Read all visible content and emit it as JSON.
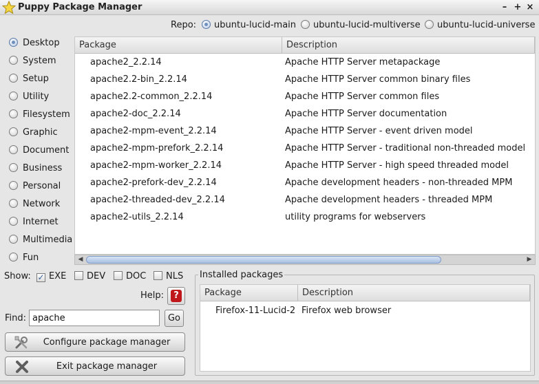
{
  "window": {
    "title": "Puppy Package Manager",
    "btn_min": "–",
    "btn_max": "+",
    "btn_close": "×"
  },
  "repo": {
    "label": "Repo:",
    "options": [
      {
        "label": "ubuntu-lucid-main",
        "selected": true
      },
      {
        "label": "ubuntu-lucid-multiverse",
        "selected": false
      },
      {
        "label": "ubuntu-lucid-universe",
        "selected": false
      }
    ]
  },
  "categories": [
    {
      "label": "Desktop",
      "selected": true
    },
    {
      "label": "System"
    },
    {
      "label": "Setup"
    },
    {
      "label": "Utility"
    },
    {
      "label": "Filesystem"
    },
    {
      "label": "Graphic"
    },
    {
      "label": "Document"
    },
    {
      "label": "Business"
    },
    {
      "label": "Personal"
    },
    {
      "label": "Network"
    },
    {
      "label": "Internet"
    },
    {
      "label": "Multimedia"
    },
    {
      "label": "Fun"
    }
  ],
  "packages": {
    "columns": [
      "Package",
      "Description"
    ],
    "rows": [
      [
        "apache2_2.2.14",
        "Apache HTTP Server metapackage"
      ],
      [
        "apache2.2-bin_2.2.14",
        "Apache HTTP Server common binary files"
      ],
      [
        "apache2.2-common_2.2.14",
        "Apache HTTP Server common files"
      ],
      [
        "apache2-doc_2.2.14",
        "Apache HTTP Server documentation"
      ],
      [
        "apache2-mpm-event_2.2.14",
        "Apache HTTP Server - event driven model"
      ],
      [
        "apache2-mpm-prefork_2.2.14",
        "Apache HTTP Server - traditional non-threaded model"
      ],
      [
        "apache2-mpm-worker_2.2.14",
        "Apache HTTP Server - high speed threaded model"
      ],
      [
        "apache2-prefork-dev_2.2.14",
        "Apache development headers - non-threaded MPM"
      ],
      [
        "apache2-threaded-dev_2.2.14",
        "Apache development headers - threaded MPM"
      ],
      [
        "apache2-utils_2.2.14",
        "utility programs for webservers"
      ]
    ]
  },
  "show": {
    "label": "Show:",
    "options": [
      {
        "label": "EXE",
        "checked": true
      },
      {
        "label": "DEV",
        "checked": false
      },
      {
        "label": "DOC",
        "checked": false
      },
      {
        "label": "NLS",
        "checked": false
      }
    ]
  },
  "help": {
    "label": "Help:",
    "glyph": "?"
  },
  "find": {
    "label": "Find:",
    "value": "apache",
    "go_label": "Go"
  },
  "buttons": {
    "configure": "Configure package manager",
    "exit": "Exit package manager"
  },
  "installed": {
    "title": "Installed packages",
    "columns": [
      "Package",
      "Description"
    ],
    "rows": [
      [
        "Firefox-11-Lucid-2",
        "Firefox web browser"
      ]
    ]
  },
  "icons": {
    "app": "star-icon",
    "configure": "tools-icon",
    "exit": "close-x-icon",
    "help": "question-icon"
  }
}
